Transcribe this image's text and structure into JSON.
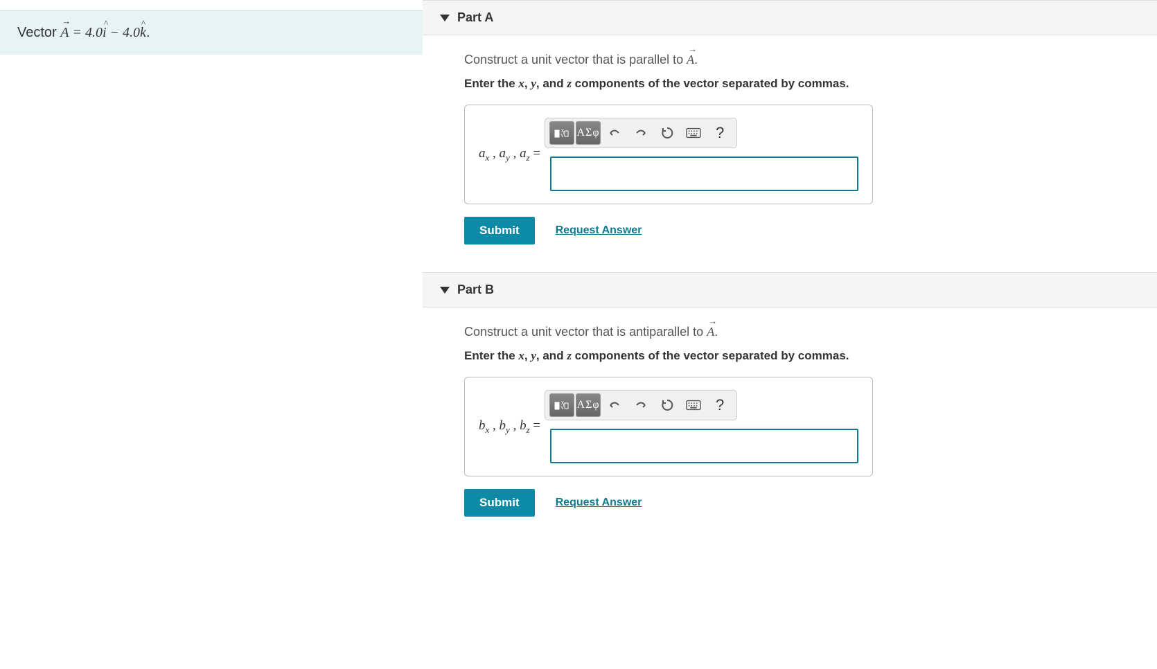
{
  "problem": {
    "prefix": "Vector ",
    "vector_var": "A",
    "equals": " = 4.0",
    "i_hat": "i",
    "minus": " − 4.0",
    "k_hat": "k",
    "period": "."
  },
  "partA": {
    "title": "Part A",
    "prompt_prefix": "Construct a unit vector that is parallel to ",
    "prompt_var": "A",
    "prompt_suffix": ".",
    "instr_prefix": "Enter the ",
    "instr_x": "x",
    "instr_c1": ", ",
    "instr_y": "y",
    "instr_c2": ", and ",
    "instr_z": "z",
    "instr_suffix": " components of the vector separated by commas.",
    "prefix_a": "a",
    "prefix_sub_x": "x",
    "prefix_sub_y": "y",
    "prefix_sub_z": "z",
    "prefix_eq": " =",
    "toolbar_greek": "ΑΣφ",
    "submit": "Submit",
    "request": "Request Answer",
    "help": "?"
  },
  "partB": {
    "title": "Part B",
    "prompt_prefix": "Construct a unit vector that is antiparallel to ",
    "prompt_var": "A",
    "prompt_suffix": ".",
    "instr_prefix": "Enter the ",
    "instr_x": "x",
    "instr_c1": ", ",
    "instr_y": "y",
    "instr_c2": ", and ",
    "instr_z": "z",
    "instr_suffix": " components of the vector separated by commas.",
    "prefix_b": "b",
    "prefix_sub_x": "x",
    "prefix_sub_y": "y",
    "prefix_sub_z": "z",
    "prefix_eq": " =",
    "toolbar_greek": "ΑΣφ",
    "submit": "Submit",
    "request": "Request Answer",
    "help": "?"
  }
}
